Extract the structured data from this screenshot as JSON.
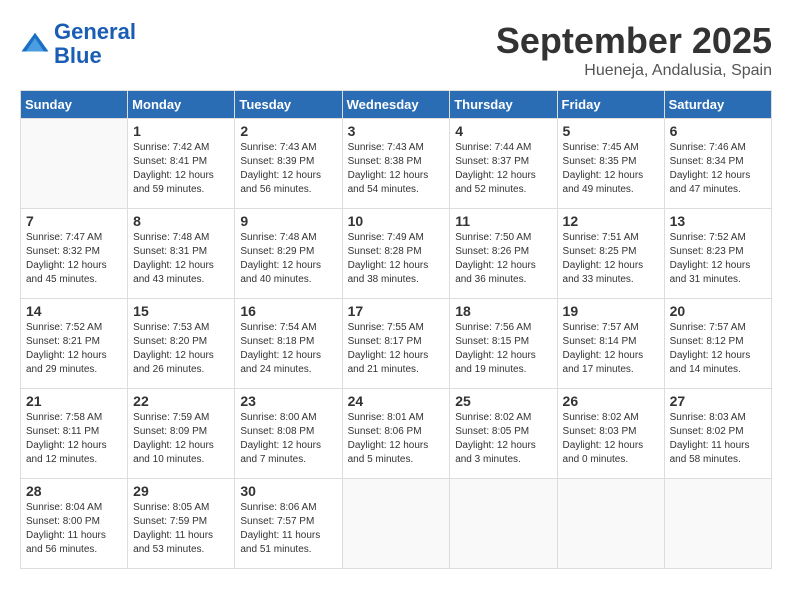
{
  "logo": {
    "line1": "General",
    "line2": "Blue"
  },
  "title": "September 2025",
  "location": "Hueneja, Andalusia, Spain",
  "days_header": [
    "Sunday",
    "Monday",
    "Tuesday",
    "Wednesday",
    "Thursday",
    "Friday",
    "Saturday"
  ],
  "weeks": [
    [
      {
        "day": "",
        "info": ""
      },
      {
        "day": "1",
        "info": "Sunrise: 7:42 AM\nSunset: 8:41 PM\nDaylight: 12 hours\nand 59 minutes."
      },
      {
        "day": "2",
        "info": "Sunrise: 7:43 AM\nSunset: 8:39 PM\nDaylight: 12 hours\nand 56 minutes."
      },
      {
        "day": "3",
        "info": "Sunrise: 7:43 AM\nSunset: 8:38 PM\nDaylight: 12 hours\nand 54 minutes."
      },
      {
        "day": "4",
        "info": "Sunrise: 7:44 AM\nSunset: 8:37 PM\nDaylight: 12 hours\nand 52 minutes."
      },
      {
        "day": "5",
        "info": "Sunrise: 7:45 AM\nSunset: 8:35 PM\nDaylight: 12 hours\nand 49 minutes."
      },
      {
        "day": "6",
        "info": "Sunrise: 7:46 AM\nSunset: 8:34 PM\nDaylight: 12 hours\nand 47 minutes."
      }
    ],
    [
      {
        "day": "7",
        "info": "Sunrise: 7:47 AM\nSunset: 8:32 PM\nDaylight: 12 hours\nand 45 minutes."
      },
      {
        "day": "8",
        "info": "Sunrise: 7:48 AM\nSunset: 8:31 PM\nDaylight: 12 hours\nand 43 minutes."
      },
      {
        "day": "9",
        "info": "Sunrise: 7:48 AM\nSunset: 8:29 PM\nDaylight: 12 hours\nand 40 minutes."
      },
      {
        "day": "10",
        "info": "Sunrise: 7:49 AM\nSunset: 8:28 PM\nDaylight: 12 hours\nand 38 minutes."
      },
      {
        "day": "11",
        "info": "Sunrise: 7:50 AM\nSunset: 8:26 PM\nDaylight: 12 hours\nand 36 minutes."
      },
      {
        "day": "12",
        "info": "Sunrise: 7:51 AM\nSunset: 8:25 PM\nDaylight: 12 hours\nand 33 minutes."
      },
      {
        "day": "13",
        "info": "Sunrise: 7:52 AM\nSunset: 8:23 PM\nDaylight: 12 hours\nand 31 minutes."
      }
    ],
    [
      {
        "day": "14",
        "info": "Sunrise: 7:52 AM\nSunset: 8:21 PM\nDaylight: 12 hours\nand 29 minutes."
      },
      {
        "day": "15",
        "info": "Sunrise: 7:53 AM\nSunset: 8:20 PM\nDaylight: 12 hours\nand 26 minutes."
      },
      {
        "day": "16",
        "info": "Sunrise: 7:54 AM\nSunset: 8:18 PM\nDaylight: 12 hours\nand 24 minutes."
      },
      {
        "day": "17",
        "info": "Sunrise: 7:55 AM\nSunset: 8:17 PM\nDaylight: 12 hours\nand 21 minutes."
      },
      {
        "day": "18",
        "info": "Sunrise: 7:56 AM\nSunset: 8:15 PM\nDaylight: 12 hours\nand 19 minutes."
      },
      {
        "day": "19",
        "info": "Sunrise: 7:57 AM\nSunset: 8:14 PM\nDaylight: 12 hours\nand 17 minutes."
      },
      {
        "day": "20",
        "info": "Sunrise: 7:57 AM\nSunset: 8:12 PM\nDaylight: 12 hours\nand 14 minutes."
      }
    ],
    [
      {
        "day": "21",
        "info": "Sunrise: 7:58 AM\nSunset: 8:11 PM\nDaylight: 12 hours\nand 12 minutes."
      },
      {
        "day": "22",
        "info": "Sunrise: 7:59 AM\nSunset: 8:09 PM\nDaylight: 12 hours\nand 10 minutes."
      },
      {
        "day": "23",
        "info": "Sunrise: 8:00 AM\nSunset: 8:08 PM\nDaylight: 12 hours\nand 7 minutes."
      },
      {
        "day": "24",
        "info": "Sunrise: 8:01 AM\nSunset: 8:06 PM\nDaylight: 12 hours\nand 5 minutes."
      },
      {
        "day": "25",
        "info": "Sunrise: 8:02 AM\nSunset: 8:05 PM\nDaylight: 12 hours\nand 3 minutes."
      },
      {
        "day": "26",
        "info": "Sunrise: 8:02 AM\nSunset: 8:03 PM\nDaylight: 12 hours\nand 0 minutes."
      },
      {
        "day": "27",
        "info": "Sunrise: 8:03 AM\nSunset: 8:02 PM\nDaylight: 11 hours\nand 58 minutes."
      }
    ],
    [
      {
        "day": "28",
        "info": "Sunrise: 8:04 AM\nSunset: 8:00 PM\nDaylight: 11 hours\nand 56 minutes."
      },
      {
        "day": "29",
        "info": "Sunrise: 8:05 AM\nSunset: 7:59 PM\nDaylight: 11 hours\nand 53 minutes."
      },
      {
        "day": "30",
        "info": "Sunrise: 8:06 AM\nSunset: 7:57 PM\nDaylight: 11 hours\nand 51 minutes."
      },
      {
        "day": "",
        "info": ""
      },
      {
        "day": "",
        "info": ""
      },
      {
        "day": "",
        "info": ""
      },
      {
        "day": "",
        "info": ""
      }
    ]
  ]
}
